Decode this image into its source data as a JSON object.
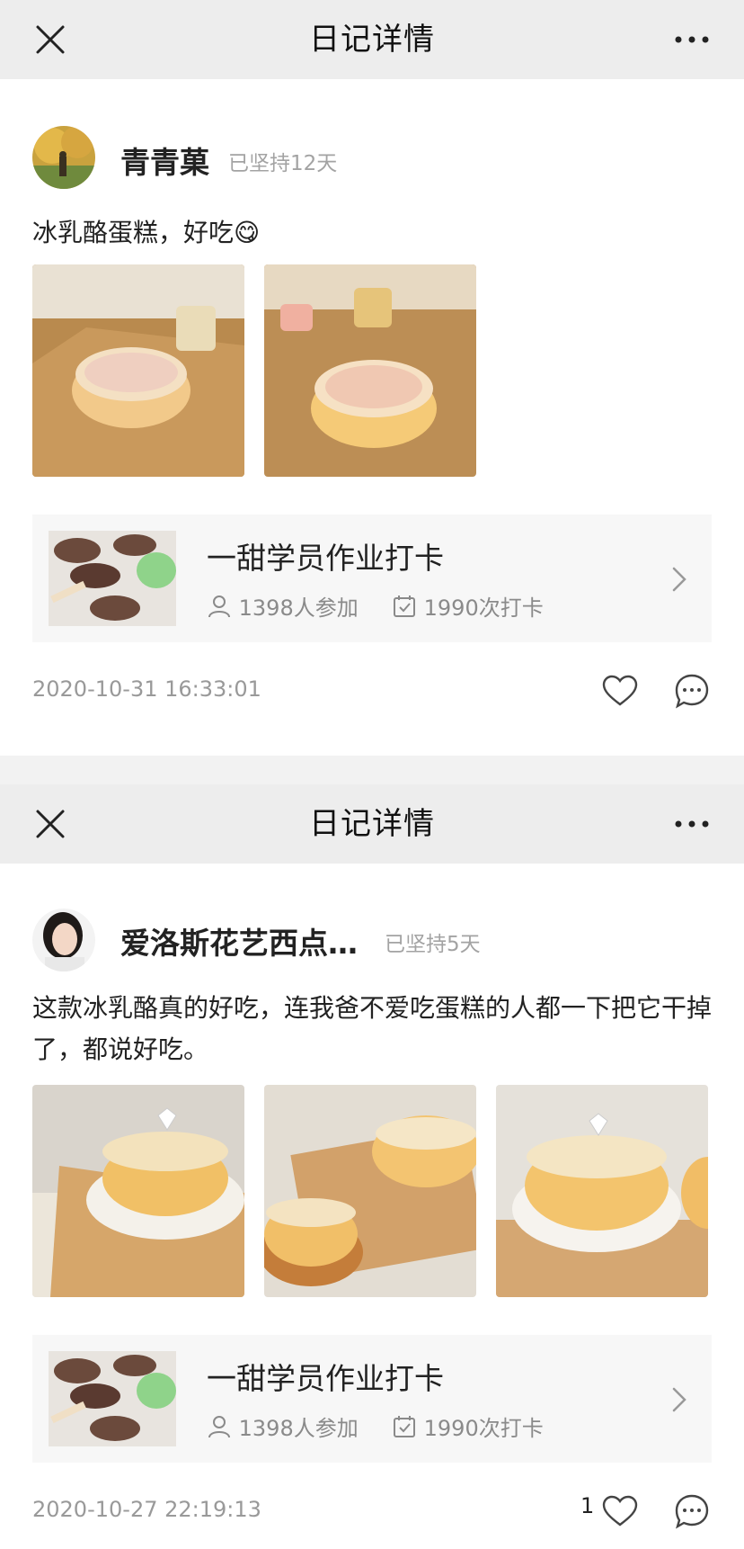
{
  "screens": [
    {
      "header": {
        "title": "日记详情"
      },
      "post": {
        "username": "青青菓",
        "persist": "已坚持12天",
        "text": "冰乳酪蛋糕，好吃😋",
        "activity": {
          "title": "一甜学员作业打卡",
          "participants": "1398人参加",
          "checkins": "1990次打卡"
        },
        "timestamp": "2020-10-31 16:33:01",
        "like_count": ""
      }
    },
    {
      "header": {
        "title": "日记详情"
      },
      "post": {
        "username": "爱洛斯花艺西点…",
        "persist": "已坚持5天",
        "text": "这款冰乳酪真的好吃，连我爸不爱吃蛋糕的人都一下把它干掉了，都说好吃。",
        "activity": {
          "title": "一甜学员作业打卡",
          "participants": "1398人参加",
          "checkins": "1990次打卡"
        },
        "timestamp": "2020-10-27 22:19:13",
        "like_count": "1"
      }
    }
  ],
  "icons": {
    "close": "close-icon",
    "more": "more-dots-icon",
    "user": "user-icon",
    "checkin": "calendar-check-icon",
    "chevron": "chevron-right-icon",
    "like": "heart-icon",
    "comment": "comment-icon"
  }
}
